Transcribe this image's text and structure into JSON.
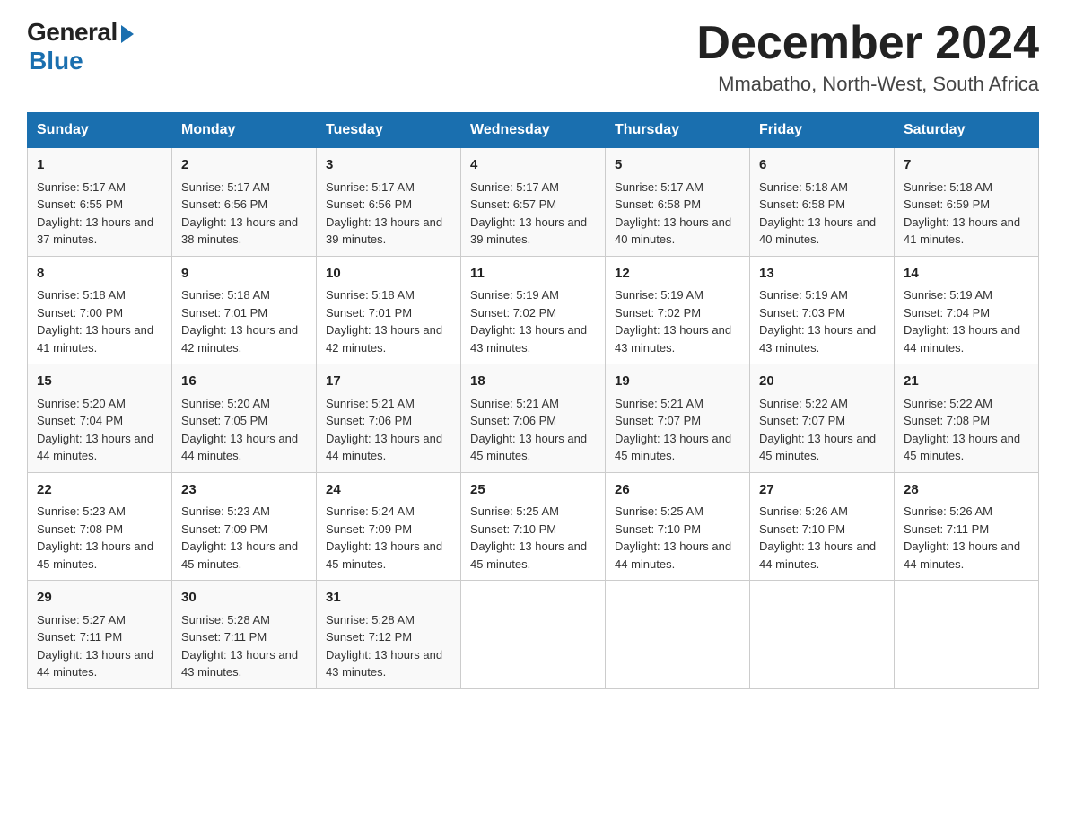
{
  "header": {
    "logo_general": "General",
    "logo_blue": "Blue",
    "month_title": "December 2024",
    "location": "Mmabatho, North-West, South Africa"
  },
  "days_of_week": [
    "Sunday",
    "Monday",
    "Tuesday",
    "Wednesday",
    "Thursday",
    "Friday",
    "Saturday"
  ],
  "weeks": [
    [
      {
        "day": "1",
        "sunrise": "5:17 AM",
        "sunset": "6:55 PM",
        "daylight": "13 hours and 37 minutes."
      },
      {
        "day": "2",
        "sunrise": "5:17 AM",
        "sunset": "6:56 PM",
        "daylight": "13 hours and 38 minutes."
      },
      {
        "day": "3",
        "sunrise": "5:17 AM",
        "sunset": "6:56 PM",
        "daylight": "13 hours and 39 minutes."
      },
      {
        "day": "4",
        "sunrise": "5:17 AM",
        "sunset": "6:57 PM",
        "daylight": "13 hours and 39 minutes."
      },
      {
        "day": "5",
        "sunrise": "5:17 AM",
        "sunset": "6:58 PM",
        "daylight": "13 hours and 40 minutes."
      },
      {
        "day": "6",
        "sunrise": "5:18 AM",
        "sunset": "6:58 PM",
        "daylight": "13 hours and 40 minutes."
      },
      {
        "day": "7",
        "sunrise": "5:18 AM",
        "sunset": "6:59 PM",
        "daylight": "13 hours and 41 minutes."
      }
    ],
    [
      {
        "day": "8",
        "sunrise": "5:18 AM",
        "sunset": "7:00 PM",
        "daylight": "13 hours and 41 minutes."
      },
      {
        "day": "9",
        "sunrise": "5:18 AM",
        "sunset": "7:01 PM",
        "daylight": "13 hours and 42 minutes."
      },
      {
        "day": "10",
        "sunrise": "5:18 AM",
        "sunset": "7:01 PM",
        "daylight": "13 hours and 42 minutes."
      },
      {
        "day": "11",
        "sunrise": "5:19 AM",
        "sunset": "7:02 PM",
        "daylight": "13 hours and 43 minutes."
      },
      {
        "day": "12",
        "sunrise": "5:19 AM",
        "sunset": "7:02 PM",
        "daylight": "13 hours and 43 minutes."
      },
      {
        "day": "13",
        "sunrise": "5:19 AM",
        "sunset": "7:03 PM",
        "daylight": "13 hours and 43 minutes."
      },
      {
        "day": "14",
        "sunrise": "5:19 AM",
        "sunset": "7:04 PM",
        "daylight": "13 hours and 44 minutes."
      }
    ],
    [
      {
        "day": "15",
        "sunrise": "5:20 AM",
        "sunset": "7:04 PM",
        "daylight": "13 hours and 44 minutes."
      },
      {
        "day": "16",
        "sunrise": "5:20 AM",
        "sunset": "7:05 PM",
        "daylight": "13 hours and 44 minutes."
      },
      {
        "day": "17",
        "sunrise": "5:21 AM",
        "sunset": "7:06 PM",
        "daylight": "13 hours and 44 minutes."
      },
      {
        "day": "18",
        "sunrise": "5:21 AM",
        "sunset": "7:06 PM",
        "daylight": "13 hours and 45 minutes."
      },
      {
        "day": "19",
        "sunrise": "5:21 AM",
        "sunset": "7:07 PM",
        "daylight": "13 hours and 45 minutes."
      },
      {
        "day": "20",
        "sunrise": "5:22 AM",
        "sunset": "7:07 PM",
        "daylight": "13 hours and 45 minutes."
      },
      {
        "day": "21",
        "sunrise": "5:22 AM",
        "sunset": "7:08 PM",
        "daylight": "13 hours and 45 minutes."
      }
    ],
    [
      {
        "day": "22",
        "sunrise": "5:23 AM",
        "sunset": "7:08 PM",
        "daylight": "13 hours and 45 minutes."
      },
      {
        "day": "23",
        "sunrise": "5:23 AM",
        "sunset": "7:09 PM",
        "daylight": "13 hours and 45 minutes."
      },
      {
        "day": "24",
        "sunrise": "5:24 AM",
        "sunset": "7:09 PM",
        "daylight": "13 hours and 45 minutes."
      },
      {
        "day": "25",
        "sunrise": "5:25 AM",
        "sunset": "7:10 PM",
        "daylight": "13 hours and 45 minutes."
      },
      {
        "day": "26",
        "sunrise": "5:25 AM",
        "sunset": "7:10 PM",
        "daylight": "13 hours and 44 minutes."
      },
      {
        "day": "27",
        "sunrise": "5:26 AM",
        "sunset": "7:10 PM",
        "daylight": "13 hours and 44 minutes."
      },
      {
        "day": "28",
        "sunrise": "5:26 AM",
        "sunset": "7:11 PM",
        "daylight": "13 hours and 44 minutes."
      }
    ],
    [
      {
        "day": "29",
        "sunrise": "5:27 AM",
        "sunset": "7:11 PM",
        "daylight": "13 hours and 44 minutes."
      },
      {
        "day": "30",
        "sunrise": "5:28 AM",
        "sunset": "7:11 PM",
        "daylight": "13 hours and 43 minutes."
      },
      {
        "day": "31",
        "sunrise": "5:28 AM",
        "sunset": "7:12 PM",
        "daylight": "13 hours and 43 minutes."
      },
      null,
      null,
      null,
      null
    ]
  ]
}
